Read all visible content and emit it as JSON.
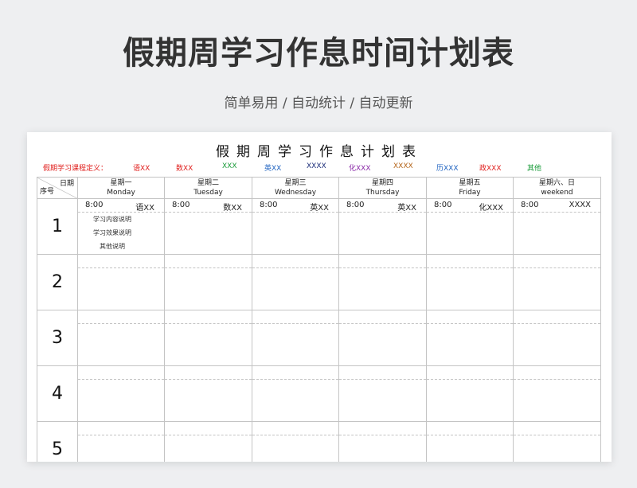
{
  "header": {
    "title": "假期周学习作息时间计划表",
    "subtitle": "简单易用 / 自动统计 / 自动更新"
  },
  "sheet": {
    "title": "假期周学习作息计划表",
    "legend_label": "假期学习课程定义：",
    "legend": [
      {
        "text": "语XX",
        "color": "#e0201e"
      },
      {
        "text": "数XX",
        "color": "#e0201e"
      },
      {
        "text": "XXX",
        "color": "#1a9b3a"
      },
      {
        "text": "英XX",
        "color": "#1e62c0"
      },
      {
        "text": "XXXX",
        "color": "#1d2f7a"
      },
      {
        "text": "化XXX",
        "color": "#8a2aa8"
      },
      {
        "text": "XXXX",
        "color": "#b4651a"
      },
      {
        "text": "历XXX",
        "color": "#1e62c0"
      },
      {
        "text": "政XXX",
        "color": "#e0201e"
      },
      {
        "text": "其他",
        "color": "#1a9b3a"
      }
    ],
    "corner_date": "日期",
    "corner_seq": "序号",
    "days": [
      {
        "cn": "星期一",
        "en": "Monday",
        "time": "8:00",
        "subject": "语XX"
      },
      {
        "cn": "星期二",
        "en": "Tuesday",
        "time": "8:00",
        "subject": "数XX"
      },
      {
        "cn": "星期三",
        "en": "Wednesday",
        "time": "8:00",
        "subject": "英XX"
      },
      {
        "cn": "星期四",
        "en": "Thursday",
        "time": "8:00",
        "subject": "英XX"
      },
      {
        "cn": "星期五",
        "en": "Friday",
        "time": "8:00",
        "subject": "化XXX"
      },
      {
        "cn": "星期六、日",
        "en": "weekend",
        "time": "8:00",
        "subject": "XXXX"
      }
    ],
    "rows": [
      "1",
      "2",
      "3",
      "4",
      "5"
    ],
    "notes": [
      "学习内容说明",
      "学习效果说明",
      "其他说明"
    ]
  }
}
